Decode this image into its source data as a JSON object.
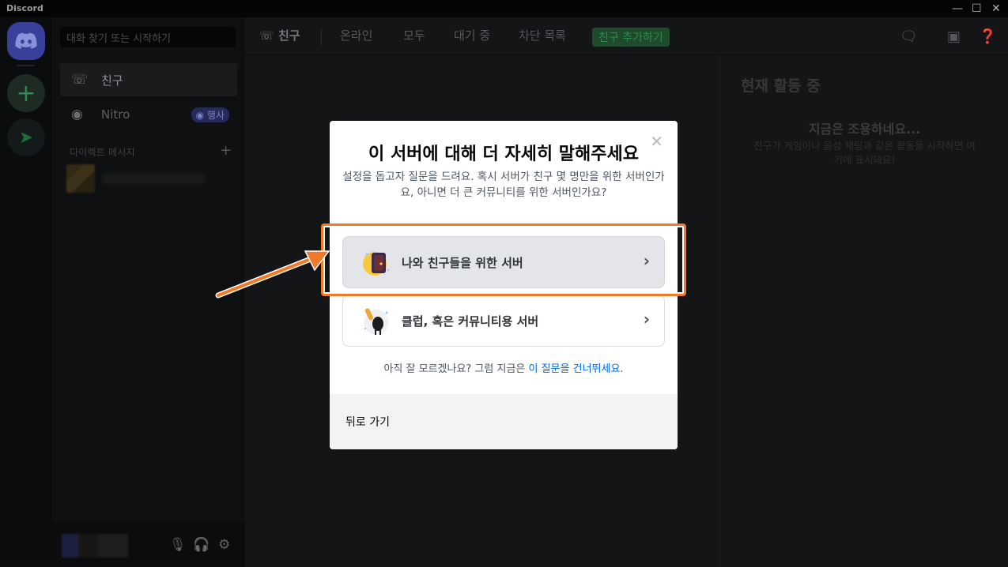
{
  "window": {
    "title": "Discord",
    "controls": [
      "minimize",
      "maximize",
      "close"
    ]
  },
  "sidebar": {
    "search_placeholder": "대화 찾기 또는 시작하기",
    "items": [
      {
        "label": "친구",
        "icon": "friends-icon"
      },
      {
        "label": "Nitro",
        "icon": "nitro-icon",
        "badge": "행사"
      }
    ],
    "dm_header": "다이렉트 메시지"
  },
  "header": {
    "title": "친구",
    "tabs": [
      "온라인",
      "모두",
      "대기 중",
      "차단 목록"
    ],
    "add_friend": "친구 추가하기"
  },
  "activity": {
    "title": "현재 활동 중",
    "quiet": "지금은 조용하네요...",
    "desc": "친구가 게임이나 음성 채팅과 같은 활동을 시작하면 여기에 표시돼요!"
  },
  "modal": {
    "title": "이 서버에 대해 더 자세히 말해주세요",
    "description": "설정을 돕고자 질문을 드려요. 혹시 서버가 친구 몇 명만을 위한 서버인가요, 아니면 더 큰 커뮤니티를 위한 서버인가요?",
    "options": [
      {
        "label": "나와 친구들을 위한 서버",
        "icon": "friends-server-illustration"
      },
      {
        "label": "클럽, 혹은 커뮤니티용 서버",
        "icon": "community-server-illustration"
      }
    ],
    "skip_prefix": "아직 잘 모르겠나요? 그럼 지금은 ",
    "skip_link": "이 질문을 건너뛰세요",
    "skip_suffix": ".",
    "back": "뒤로 가기"
  },
  "colors": {
    "annotation": "#f07a2a",
    "link": "#0067e0",
    "blurple": "#5865f2"
  }
}
